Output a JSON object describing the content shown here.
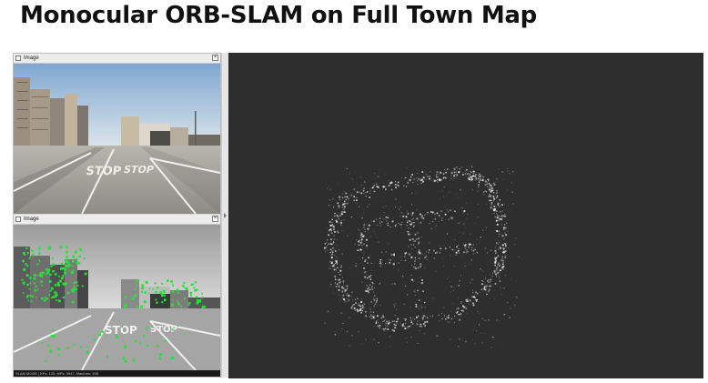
{
  "title": "Monocular ORB-SLAM on Full Town Map",
  "windows": [
    {
      "title": "Image",
      "close_glyph": "×",
      "icon": "window-icon"
    },
    {
      "title": "Image",
      "close_glyph": "×",
      "icon": "window-icon"
    }
  ],
  "frame_status": "SLAM MODE | KFs: 125, MPs: 3947, Matches: 198",
  "road_marking": "STOP",
  "colors": {
    "feature_point": "#27e03a",
    "viewer_background": "#2e2e2e",
    "map_point": "#e6e6e6"
  }
}
